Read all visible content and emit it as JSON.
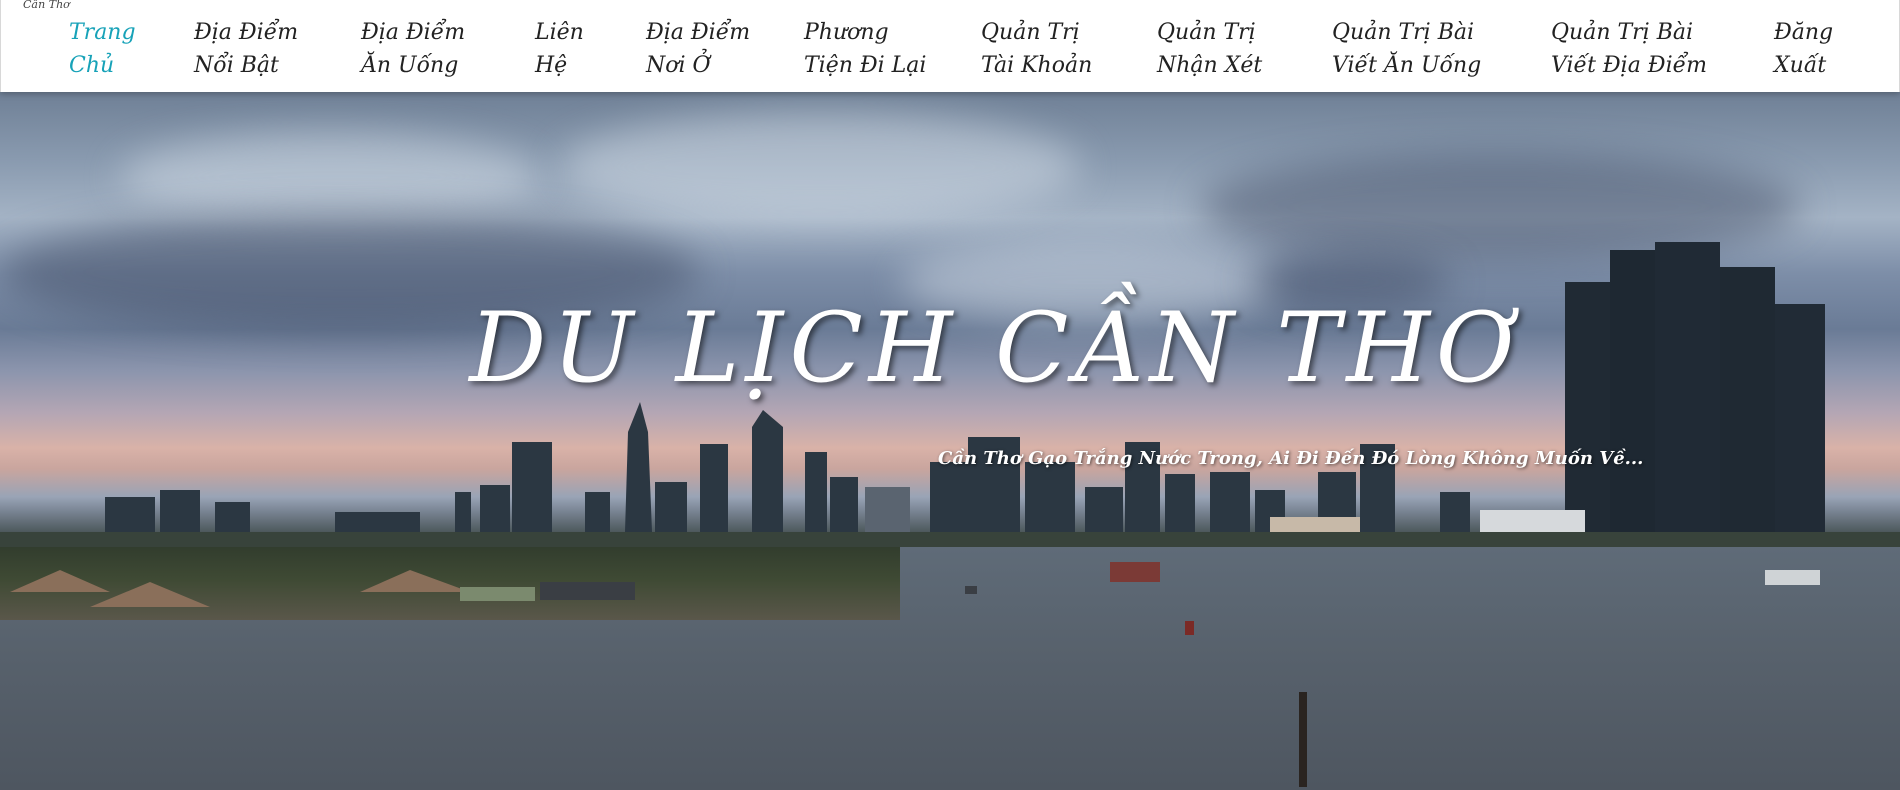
{
  "site": {
    "logo_text": "Cần Thơ"
  },
  "nav": {
    "items": [
      {
        "line1": "Trang",
        "line2": "Chủ",
        "active": true
      },
      {
        "line1": "Địa Điểm",
        "line2": "Nổi Bật"
      },
      {
        "line1": "Địa Điểm",
        "line2": "Ăn Uống"
      },
      {
        "line1": "Liên",
        "line2": "Hệ"
      },
      {
        "line1": "Địa Điểm",
        "line2": "Nơi Ở"
      },
      {
        "line1": "Phương",
        "line2": "Tiện Đi Lại"
      },
      {
        "line1": "Quản Trị",
        "line2": "Tài Khoản"
      },
      {
        "line1": "Quản Trị",
        "line2": "Nhận Xét"
      },
      {
        "line1": "Quản Trị Bài",
        "line2": "Viết Ăn Uống"
      },
      {
        "line1": "Quản Trị Bài",
        "line2": "Viết Địa Điểm"
      },
      {
        "line1": "Đăng",
        "line2": "Xuất"
      }
    ]
  },
  "hero": {
    "title": "DU LỊCH CẦN THƠ",
    "subtitle": "Cần Thơ Gạo Trắng Nước Trong, Ai Đi Đến Đó Lòng Không Muốn Về..."
  },
  "colors": {
    "active_nav": "#17a2b8",
    "nav_text": "#222222",
    "hero_text": "#ffffff"
  }
}
